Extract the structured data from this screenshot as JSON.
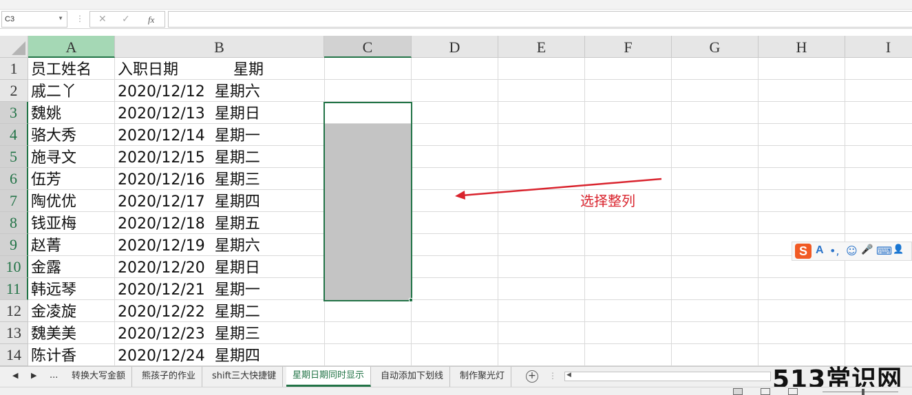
{
  "formula_bar": {
    "name_box": "C3",
    "cancel_glyph": "✕",
    "confirm_glyph": "✓",
    "fx_label": "fx",
    "formula_value": ""
  },
  "columns": [
    "A",
    "B",
    "C",
    "D",
    "E",
    "F",
    "G",
    "H",
    "I"
  ],
  "rows": [
    "1",
    "2",
    "3",
    "4",
    "5",
    "6",
    "7",
    "8",
    "9",
    "10",
    "11",
    "12",
    "13",
    "14"
  ],
  "header_row": {
    "a": "员工姓名",
    "b_date": "入职日期",
    "b_week": "星期"
  },
  "data_rows": [
    {
      "name": "戚二丫",
      "date": "2020/12/12",
      "week": "星期六"
    },
    {
      "name": "魏姚",
      "date": "2020/12/13",
      "week": "星期日"
    },
    {
      "name": "骆大秀",
      "date": "2020/12/14",
      "week": "星期一"
    },
    {
      "name": "施寻文",
      "date": "2020/12/15",
      "week": "星期二"
    },
    {
      "name": "伍芳",
      "date": "2020/12/16",
      "week": "星期三"
    },
    {
      "name": "陶优优",
      "date": "2020/12/17",
      "week": "星期四"
    },
    {
      "name": "钱亚梅",
      "date": "2020/12/18",
      "week": "星期五"
    },
    {
      "name": "赵菁",
      "date": "2020/12/19",
      "week": "星期六"
    },
    {
      "name": "金露",
      "date": "2020/12/20",
      "week": "星期日"
    },
    {
      "name": "韩远琴",
      "date": "2020/12/21",
      "week": "星期一"
    },
    {
      "name": "金凌旋",
      "date": "2020/12/22",
      "week": "星期二"
    },
    {
      "name": "魏美美",
      "date": "2020/12/23",
      "week": "星期三"
    },
    {
      "name": "陈计香",
      "date": "2020/12/24",
      "week": "星期四"
    }
  ],
  "annotation": {
    "text": "选择整列",
    "color": "#d9232d"
  },
  "ime_toolbar": {
    "logo": "S",
    "icons": [
      "A",
      "•,",
      "☺",
      "🎤",
      "⌨",
      "👤"
    ]
  },
  "sheet_tabs": {
    "nav": [
      "◀",
      "▶",
      "..."
    ],
    "tabs": [
      "转换大写金额",
      "熊孩子的作业",
      "shift三大快捷键",
      "星期日期同时显示",
      "自动添加下划线",
      "制作聚光灯"
    ],
    "active_index": 3,
    "add_glyph": "+",
    "more_glyph": "⋮",
    "scroll_left": "◀"
  },
  "watermark": "513常识网",
  "colors": {
    "accent": "#217346",
    "selection_fill": "#c4c4c4",
    "col_a_header": "#a5d8b5"
  }
}
